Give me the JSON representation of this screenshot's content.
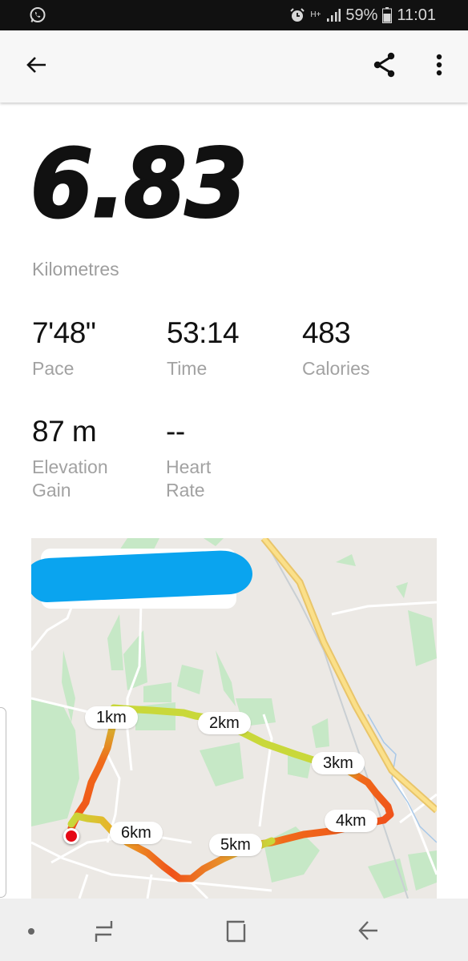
{
  "status_bar": {
    "notification_icon": "whatsapp-icon",
    "network": "H+",
    "battery": "59%",
    "time": "11:01",
    "icons": [
      "alarm-icon",
      "network-hplus-icon",
      "signal-icon",
      "battery-icon"
    ]
  },
  "app_bar": {
    "back_icon": "arrow-left-icon",
    "share_icon": "share-icon",
    "more_icon": "more-vertical-icon"
  },
  "summary": {
    "distance_value": "6.83",
    "distance_unit": "Kilometres"
  },
  "stats": [
    {
      "value": "7'48\"",
      "label": "Pace"
    },
    {
      "value": "53:14",
      "label": "Time"
    },
    {
      "value": "483",
      "label": "Calories"
    },
    {
      "value": "87 m",
      "label": "Elevation Gain"
    },
    {
      "value": "--",
      "label": "Heart Rate"
    }
  ],
  "map": {
    "title_redacted": true,
    "redaction_color": "#0aa4ef",
    "km_markers": [
      "1km",
      "2km",
      "3km",
      "4km",
      "5km",
      "6km"
    ],
    "pace_colors": {
      "fast": "#c8e03a",
      "medium": "#e8b32a",
      "slow": "#f0521a"
    },
    "start_marker_color": "#e50914"
  },
  "nav_bar": {
    "items": [
      "dot-indicator-icon",
      "recent-apps-icon",
      "home-icon",
      "back-icon"
    ]
  }
}
